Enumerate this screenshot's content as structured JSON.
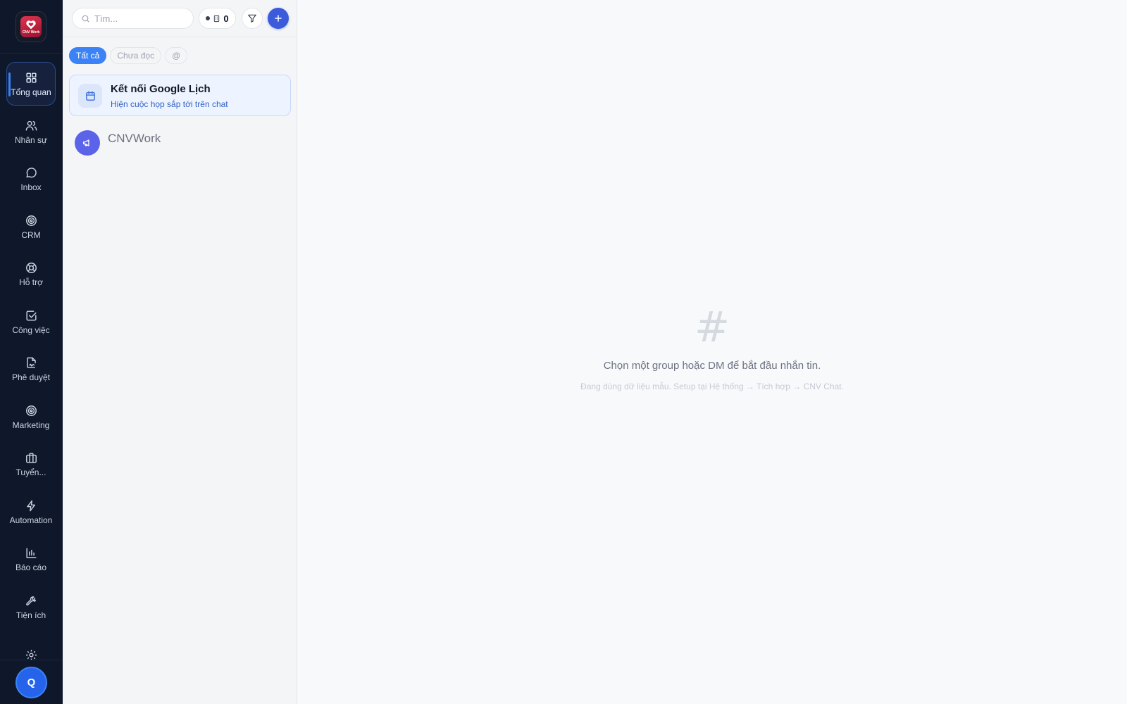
{
  "app": {
    "logo_text": "CNV Work",
    "accent_color": "#3b82f6",
    "rail_color": "#0f172a"
  },
  "sidebar": {
    "items": [
      {
        "label": "Tổng quan",
        "icon": "grid-icon",
        "active": true
      },
      {
        "label": "Nhân sự",
        "icon": "users-icon",
        "active": false
      },
      {
        "label": "Inbox",
        "icon": "chat-bubble-icon",
        "active": false
      },
      {
        "label": "CRM",
        "icon": "target-icon",
        "active": false
      },
      {
        "label": "Hỗ trợ",
        "icon": "lifebuoy-icon",
        "active": false
      },
      {
        "label": "Công việc",
        "icon": "checkbox-icon",
        "active": false
      },
      {
        "label": "Phê duyệt",
        "icon": "file-signature-icon",
        "active": false
      },
      {
        "label": "Marketing",
        "icon": "target-icon",
        "active": false
      },
      {
        "label": "Tuyển...",
        "icon": "briefcase-icon",
        "active": false
      },
      {
        "label": "Automation",
        "icon": "lightning-icon",
        "active": false
      },
      {
        "label": "Báo cáo",
        "icon": "bar-chart-icon",
        "active": false
      },
      {
        "label": "Tiện ích",
        "icon": "wrench-icon",
        "active": false
      }
    ],
    "partial_item_icon": "gear-icon",
    "user_initial": "Q"
  },
  "chat_panel": {
    "search_placeholder": "Tìm...",
    "online_count": "0",
    "filters": {
      "all": "Tất cả",
      "unread": "Chưa đọc",
      "mentions": "@"
    },
    "google_calendar": {
      "title": "Kết nối Google Lịch",
      "subtitle": "Hiện cuộc họp sắp tới trên chat"
    },
    "conversations": [
      {
        "name": "CNVWork",
        "icon": "megaphone-icon"
      }
    ]
  },
  "empty_state": {
    "symbol": "#",
    "title": "Chọn một group hoặc DM để bắt đầu nhắn tin.",
    "hint": "Đang dùng dữ liệu mẫu. Setup tại Hệ thống → Tích hợp → CNV Chat."
  }
}
